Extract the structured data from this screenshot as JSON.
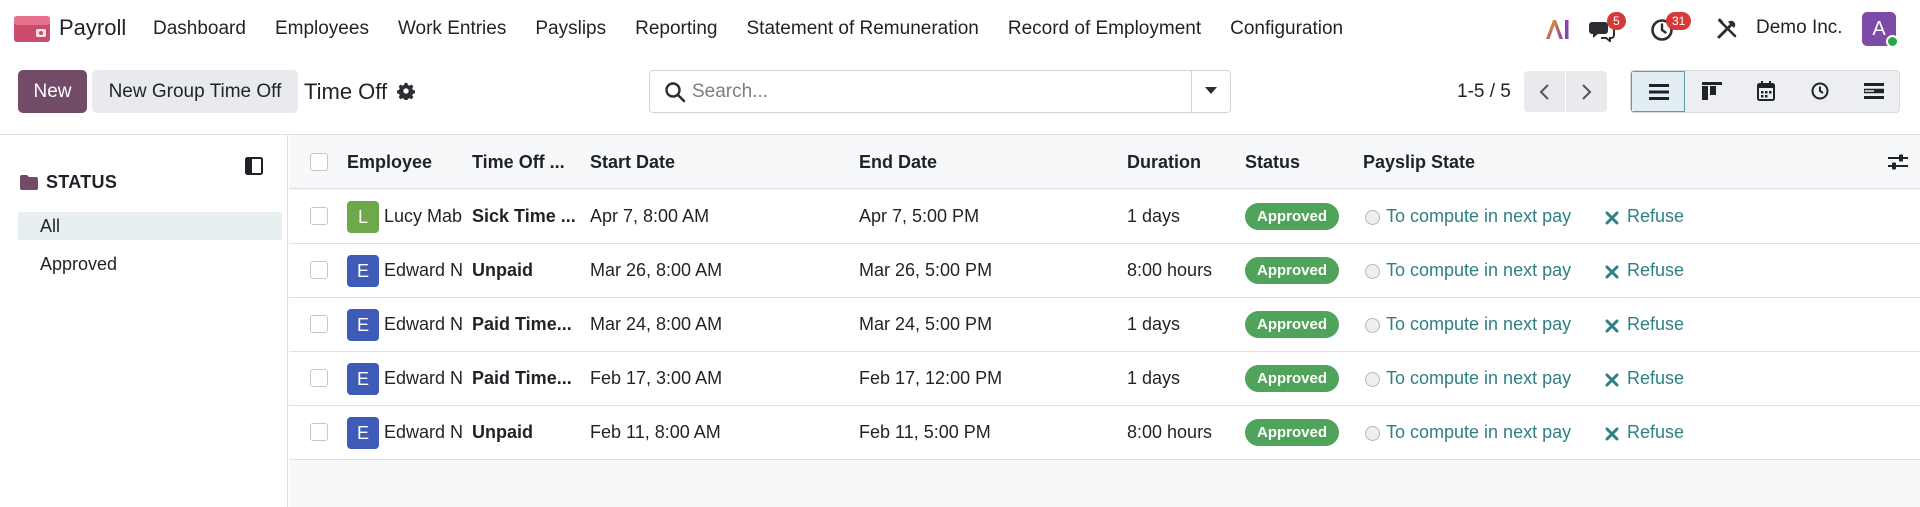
{
  "app": {
    "name": "Payroll",
    "menu": [
      "Dashboard",
      "Employees",
      "Work Entries",
      "Payslips",
      "Reporting",
      "Statement of Remuneration",
      "Record of Employment",
      "Configuration"
    ],
    "ai_label": "AI",
    "messages_count": "5",
    "activities_count": "31",
    "company": "Demo Inc.",
    "user_initial": "A"
  },
  "control": {
    "new_label": "New",
    "new_group_label": "New Group Time Off",
    "title": "Time Off",
    "search_placeholder": "Search...",
    "pager": "1-5 / 5"
  },
  "sidebar": {
    "title": "STATUS",
    "items": [
      {
        "label": "All",
        "active": true
      },
      {
        "label": "Approved",
        "active": false
      }
    ]
  },
  "table": {
    "columns": [
      "Employee",
      "Time Off ...",
      "Start Date",
      "End Date",
      "Duration",
      "Status",
      "Payslip State"
    ],
    "rows": [
      {
        "initial": "L",
        "avatar_color": "#6fa84a",
        "employee": "Lucy Mab",
        "type": "Sick Time ...",
        "start": "Apr 7, 8:00 AM",
        "end": "Apr 7, 5:00 PM",
        "duration": "1 days",
        "status": "Approved",
        "payslip": "To compute in next pay",
        "action": "Refuse"
      },
      {
        "initial": "E",
        "avatar_color": "#3e5bb8",
        "employee": "Edward N",
        "type": "Unpaid",
        "start": "Mar 26, 8:00 AM",
        "end": "Mar 26, 5:00 PM",
        "duration": "8:00 hours",
        "status": "Approved",
        "payslip": "To compute in next pay",
        "action": "Refuse"
      },
      {
        "initial": "E",
        "avatar_color": "#3e5bb8",
        "employee": "Edward N",
        "type": "Paid Time...",
        "start": "Mar 24, 8:00 AM",
        "end": "Mar 24, 5:00 PM",
        "duration": "1 days",
        "status": "Approved",
        "payslip": "To compute in next pay",
        "action": "Refuse"
      },
      {
        "initial": "E",
        "avatar_color": "#3e5bb8",
        "employee": "Edward N",
        "type": "Paid Time...",
        "start": "Feb 17, 3:00 AM",
        "end": "Feb 17, 12:00 PM",
        "duration": "1 days",
        "status": "Approved",
        "payslip": "To compute in next pay",
        "action": "Refuse"
      },
      {
        "initial": "E",
        "avatar_color": "#3e5bb8",
        "employee": "Edward N",
        "type": "Unpaid",
        "start": "Feb 11, 8:00 AM",
        "end": "Feb 11, 5:00 PM",
        "duration": "8:00 hours",
        "status": "Approved",
        "payslip": "To compute in next pay",
        "action": "Refuse"
      }
    ]
  },
  "colors": {
    "brand": "#714b67",
    "accent_link": "#2f7f86",
    "status_green": "#4fa35a",
    "badge_red": "#d53a3a"
  },
  "icons": {
    "messages": "chat-icon",
    "activities": "clock-icon",
    "settings": "tools-icon",
    "views": [
      "list-view-icon",
      "kanban-view-icon",
      "calendar-view-icon",
      "activity-view-icon",
      "gantt-view-icon"
    ]
  }
}
